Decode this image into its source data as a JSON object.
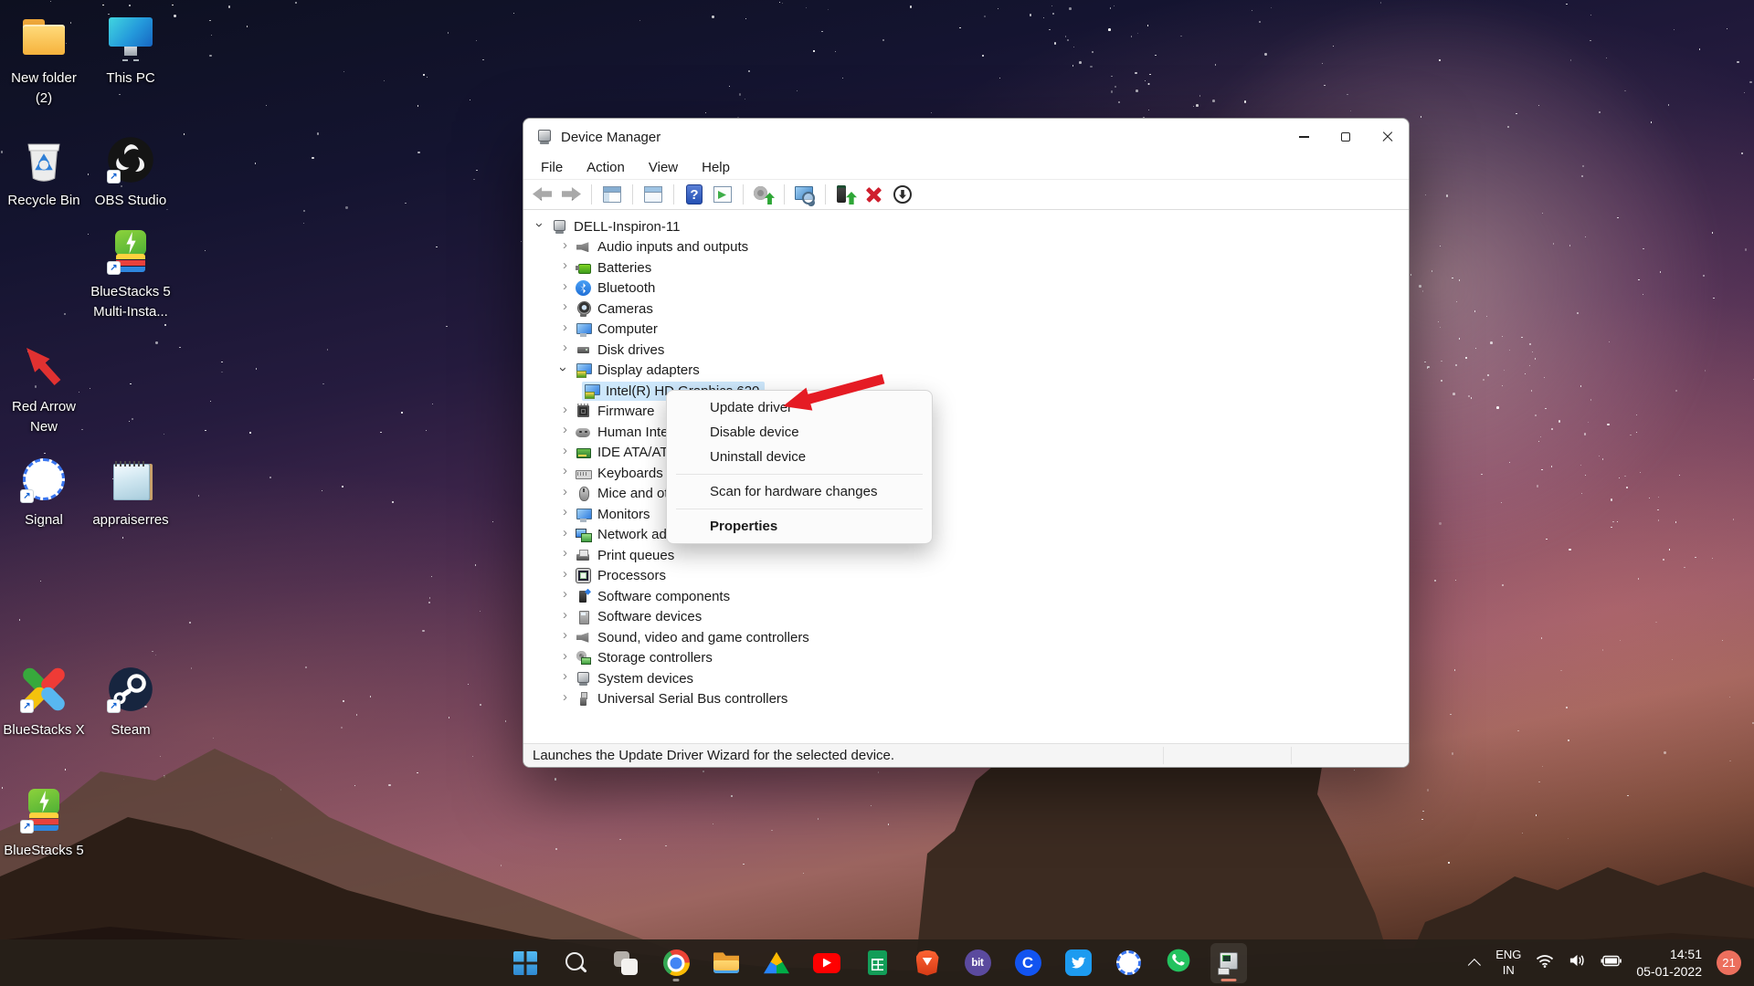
{
  "colors": {
    "selection": "#cde7fb",
    "arrow_red": "#e51b24",
    "badge": "#ec6f5d",
    "taskbar_bg": "#272019"
  },
  "desktop": {
    "icons": [
      {
        "name": "new-folder-2",
        "label": "New folder\n(2)"
      },
      {
        "name": "this-pc",
        "label": "This PC"
      },
      {
        "name": "recycle-bin",
        "label": "Recycle Bin"
      },
      {
        "name": "obs-studio",
        "label": "OBS Studio"
      },
      {
        "name": "bluestacks-5-multi",
        "label": "BlueStacks 5\nMulti-Insta..."
      },
      {
        "name": "red-arrow-new",
        "label": "Red Arrow\nNew"
      },
      {
        "name": "signal",
        "label": "Signal"
      },
      {
        "name": "appraiserres",
        "label": "appraiserres"
      },
      {
        "name": "bluestacks-x",
        "label": "BlueStacks X"
      },
      {
        "name": "steam",
        "label": "Steam"
      },
      {
        "name": "bluestacks-5",
        "label": "BlueStacks 5"
      }
    ]
  },
  "device_manager": {
    "title": "Device Manager",
    "menu": {
      "items": [
        "File",
        "Action",
        "View",
        "Help"
      ]
    },
    "tree": {
      "root": "DELL-Inspiron-11",
      "items": [
        {
          "label": "Audio inputs and outputs"
        },
        {
          "label": "Batteries"
        },
        {
          "label": "Bluetooth"
        },
        {
          "label": "Cameras"
        },
        {
          "label": "Computer"
        },
        {
          "label": "Disk drives"
        },
        {
          "label": "Display adapters"
        },
        {
          "label": "Intel(R) HD Graphics 620"
        },
        {
          "label": "Firmware"
        },
        {
          "label": "Human Interface Devices"
        },
        {
          "label": "IDE ATA/ATAPI controllers"
        },
        {
          "label": "Keyboards"
        },
        {
          "label": "Mice and other pointing devices"
        },
        {
          "label": "Monitors"
        },
        {
          "label": "Network adapters"
        },
        {
          "label": "Print queues"
        },
        {
          "label": "Processors"
        },
        {
          "label": "Software components"
        },
        {
          "label": "Software devices"
        },
        {
          "label": "Sound, video and game controllers"
        },
        {
          "label": "Storage controllers"
        },
        {
          "label": "System devices"
        },
        {
          "label": "Universal Serial Bus controllers"
        }
      ]
    },
    "context_menu": {
      "items": [
        "Update driver",
        "Disable device",
        "Uninstall device",
        "Scan for hardware changes",
        "Properties"
      ]
    },
    "status": "Launches the Update Driver Wizard for the selected device."
  },
  "taskbar": {
    "bit_label": "bit",
    "coinbase_label": "C",
    "tray": {
      "lang_line1": "ENG",
      "lang_line2": "IN",
      "time": "14:51",
      "date": "05-01-2022",
      "badge": "21"
    }
  }
}
